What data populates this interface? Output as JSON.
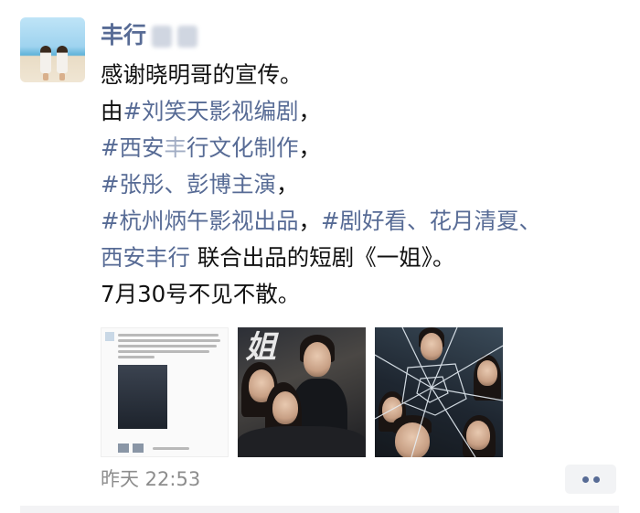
{
  "moment": {
    "username": "丰行",
    "text": {
      "line1": "感谢晓明哥的宣传。",
      "line2_pre": "由",
      "line2_tag": "#刘笑天影视编剧",
      "line2_post": "，",
      "line3_tag_a": "#西安",
      "line3_tag_b": "丰",
      "line3_tag_c": "行文化制作",
      "line3_post": "，",
      "line4_tag": "#张彤",
      "line4_sep": "、",
      "line4_tag2": "彭博主演",
      "line4_post": "，",
      "line5_tag": "#杭州炳午影视出品",
      "line5_sep": "，",
      "line5_tag2": "#剧好看、花月清夏、",
      "line6_tag": "西安丰行",
      "line6_post": " 联合出品的短剧《一姐》。",
      "line7": "7月30号不见不散。"
    },
    "photos": [
      {
        "label": "screenshot-of-post"
      },
      {
        "label": "poster-cast",
        "title": "姐"
      },
      {
        "label": "poster-broken-glass"
      }
    ],
    "timestamp": "昨天 22:53"
  }
}
